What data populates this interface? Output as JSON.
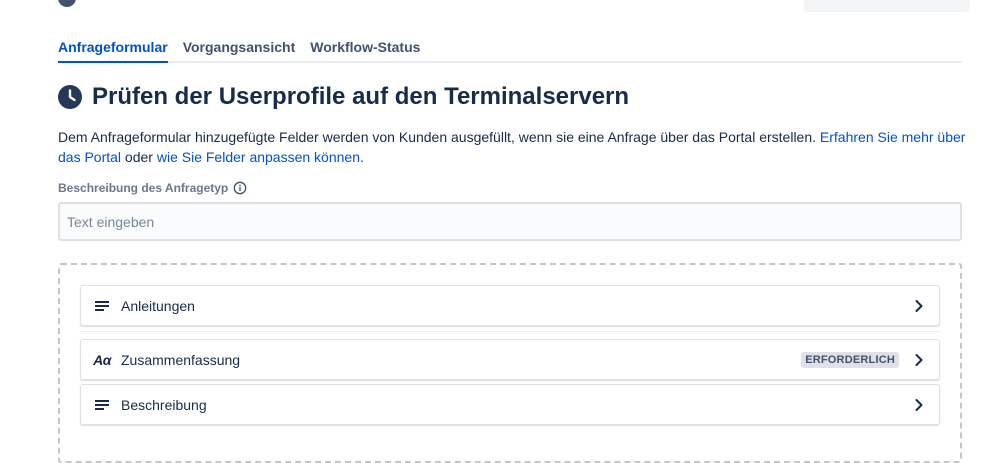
{
  "tabs": [
    {
      "label": "Anfrageformular",
      "active": true
    },
    {
      "label": "Vorgangsansicht",
      "active": false
    },
    {
      "label": "Workflow-Status",
      "active": false
    }
  ],
  "page": {
    "title": "Prüfen der Userprofile auf den Terminalservern",
    "title_icon": "clock-icon"
  },
  "description": {
    "text": "Dem Anfrageformular hinzugefügte Felder werden von Kunden ausgefüllt, wenn sie eine Anfrage über das Portal erstellen. ",
    "link1": "Erfahren Sie mehr über das Portal",
    "middle": " oder ",
    "link2": "wie Sie Felder anpassen können",
    "end": "."
  },
  "request_type_description": {
    "label": "Beschreibung des Anfragetyp",
    "placeholder": "Text eingeben",
    "value": ""
  },
  "fields": [
    {
      "name": "Anleitungen",
      "icon": "lines-icon",
      "badge": ""
    },
    {
      "name": "Zusammenfassung",
      "icon": "text-aa-icon",
      "icon_text": "Aα",
      "badge": "ERFORDERLICH"
    },
    {
      "name": "Beschreibung",
      "icon": "lines-icon",
      "badge": ""
    }
  ],
  "colors": {
    "accent": "#0052cc",
    "text": "#172b4d",
    "muted": "#6b778c",
    "border": "#dfe1e6"
  }
}
